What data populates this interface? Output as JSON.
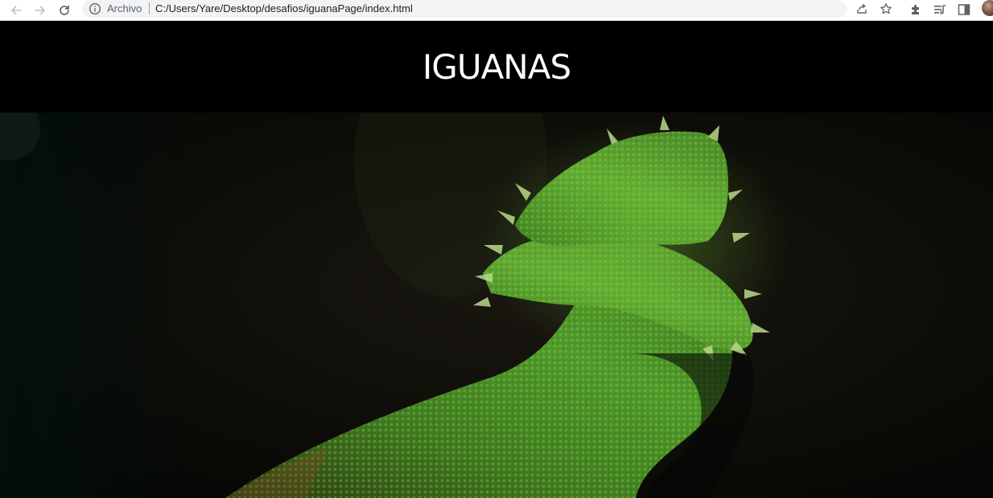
{
  "browser": {
    "url_scheme_label": "Archivo",
    "url": "C:/Users/Yare/Desktop/desafios/iguanaPage/index.html",
    "icons": {
      "back": "arrow-left-icon",
      "forward": "arrow-right-icon",
      "reload": "reload-icon",
      "info": "info-icon",
      "share": "share-icon",
      "bookmark": "star-icon",
      "extensions": "puzzle-icon",
      "reading_list": "reading-list-icon",
      "side_panel": "side-panel-icon",
      "profile": "avatar"
    }
  },
  "page": {
    "title": "IGUANAS",
    "header_background": "#000000",
    "title_color": "#ffffff",
    "hero_image": "green bearded dragon on dark background"
  }
}
